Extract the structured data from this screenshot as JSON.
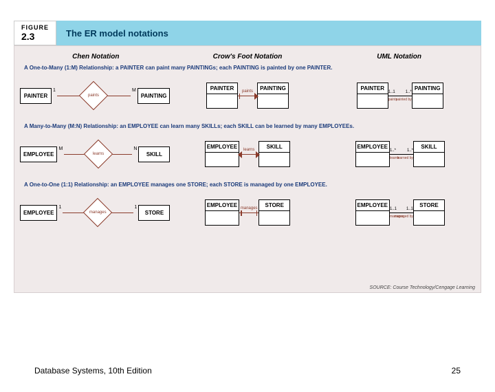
{
  "figure": {
    "label": "FIGURE",
    "number": "2.3",
    "title": "The ER model notations"
  },
  "columns": {
    "chen": "Chen Notation",
    "crow": "Crow's Foot Notation",
    "uml": "UML Notation"
  },
  "rows": [
    {
      "desc": "A One-to-Many (1:M) Relationship: a PAINTER can paint many PAINTINGs; each PAINTING is painted by one PAINTER.",
      "left_entity": "PAINTER",
      "right_entity": "PAINTING",
      "chen_rel": "paints",
      "chen_left_card": "1",
      "chen_right_card": "M",
      "crow_rel": "paints",
      "uml_left_card": "1..1",
      "uml_right_card": "1..*",
      "uml_left_role": "paints",
      "uml_right_role": "painted by"
    },
    {
      "desc": "A Many-to-Many (M:N) Relationship: an EMPLOYEE can learn many SKILLs; each SKILL can be learned by many EMPLOYEEs.",
      "left_entity": "EMPLOYEE",
      "right_entity": "SKILL",
      "chen_rel": "learns",
      "chen_left_card": "M",
      "chen_right_card": "N",
      "crow_rel": "learns",
      "uml_left_card": "1..*",
      "uml_right_card": "1..*",
      "uml_left_role": "learns",
      "uml_right_role": "learned by"
    },
    {
      "desc": "A One-to-One (1:1) Relationship: an EMPLOYEE manages one STORE; each STORE is managed by one EMPLOYEE.",
      "left_entity": "EMPLOYEE",
      "right_entity": "STORE",
      "chen_rel": "manages",
      "chen_left_card": "1",
      "chen_right_card": "1",
      "crow_rel": "manages",
      "uml_left_card": "1..1",
      "uml_right_card": "1..1",
      "uml_left_role": "manages",
      "uml_right_role": "managed by"
    }
  ],
  "source": "SOURCE: Course Technology/Cengage Learning",
  "footer": {
    "book": "Database Systems, 10th Edition",
    "page": "25"
  }
}
